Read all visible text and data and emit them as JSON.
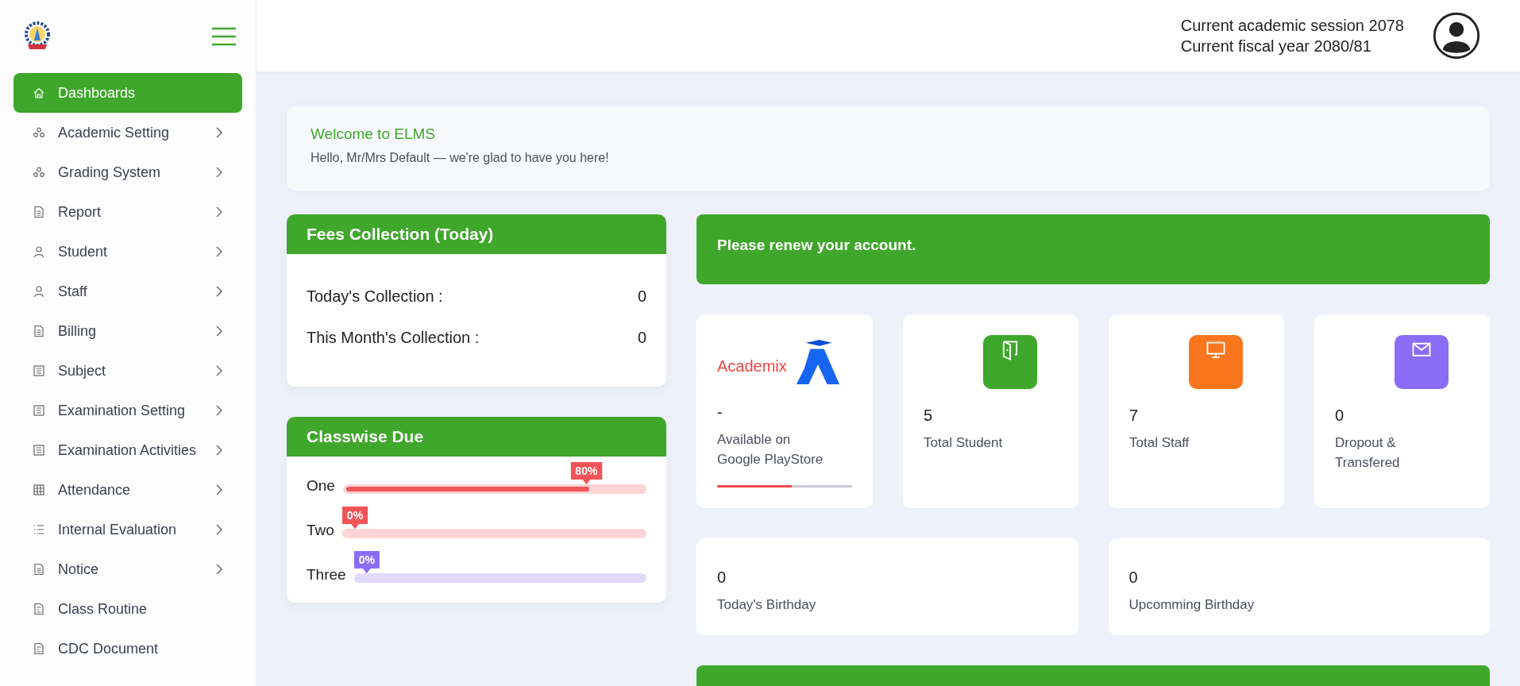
{
  "sidebar": {
    "items": [
      {
        "label": "Dashboards",
        "kind": "home",
        "selected": true,
        "has_submenu": false
      },
      {
        "label": "Academic Setting",
        "kind": "nodes",
        "selected": false,
        "has_submenu": true
      },
      {
        "label": "Grading System",
        "kind": "nodes",
        "selected": false,
        "has_submenu": true
      },
      {
        "label": "Report",
        "kind": "doc",
        "selected": false,
        "has_submenu": true
      },
      {
        "label": "Student",
        "kind": "user",
        "selected": false,
        "has_submenu": true
      },
      {
        "label": "Staff",
        "kind": "user",
        "selected": false,
        "has_submenu": true
      },
      {
        "label": "Billing",
        "kind": "doc",
        "selected": false,
        "has_submenu": true
      },
      {
        "label": "Subject",
        "kind": "sheet",
        "selected": false,
        "has_submenu": true
      },
      {
        "label": "Examination Setting",
        "kind": "sheet",
        "selected": false,
        "has_submenu": true
      },
      {
        "label": "Examination Activities",
        "kind": "sheet",
        "selected": false,
        "has_submenu": true
      },
      {
        "label": "Attendance",
        "kind": "grid",
        "selected": false,
        "has_submenu": true
      },
      {
        "label": "Internal Evaluation",
        "kind": "list",
        "selected": false,
        "has_submenu": true
      },
      {
        "label": "Notice",
        "kind": "doc",
        "selected": false,
        "has_submenu": true
      },
      {
        "label": "Class Routine",
        "kind": "file",
        "selected": false,
        "has_submenu": false
      },
      {
        "label": "CDC Document",
        "kind": "file",
        "selected": false,
        "has_submenu": false
      }
    ]
  },
  "header": {
    "session": "Current academic session 2078",
    "fiscal_year": "Current fiscal year 2080/81"
  },
  "welcome": {
    "title": "Welcome to ELMS",
    "message": "Hello, Mr/Mrs Default — we're glad to have you here!"
  },
  "fees": {
    "title": "Fees Collection (Today)",
    "rows": [
      {
        "label": "Today's Collection :",
        "value": "0"
      },
      {
        "label": "This Month's Collection :",
        "value": "0"
      }
    ]
  },
  "classwise_due": {
    "title": "Classwise Due",
    "rows": [
      {
        "label": "One",
        "level": 0.8,
        "reading": "80%",
        "color": "#f25457"
      },
      {
        "label": "Two",
        "level": 0,
        "reading": "0%",
        "color": "#f25457"
      },
      {
        "label": "Three",
        "level": 0,
        "reading": "0%",
        "color": "#8b6cf6"
      }
    ]
  },
  "renew_notice": "Please renew your account.",
  "app_card": {
    "brand": "Academix",
    "value": "-",
    "label": "Available on Google PlayStore",
    "level": 0.55
  },
  "stats": [
    {
      "value": "5",
      "label": "Total Student",
      "kind": "door",
      "color": "#3fa72b"
    },
    {
      "value": "7",
      "label": "Total Staff",
      "kind": "monitor",
      "color": "#fa761e"
    },
    {
      "value": "0",
      "label": "Dropout & Transfered",
      "kind": "mail",
      "color": "#8b6cf6"
    }
  ],
  "birthdays": [
    {
      "value": "0",
      "label": "Today's Birthday"
    },
    {
      "value": "0",
      "label": "Upcomming Birthday"
    }
  ]
}
